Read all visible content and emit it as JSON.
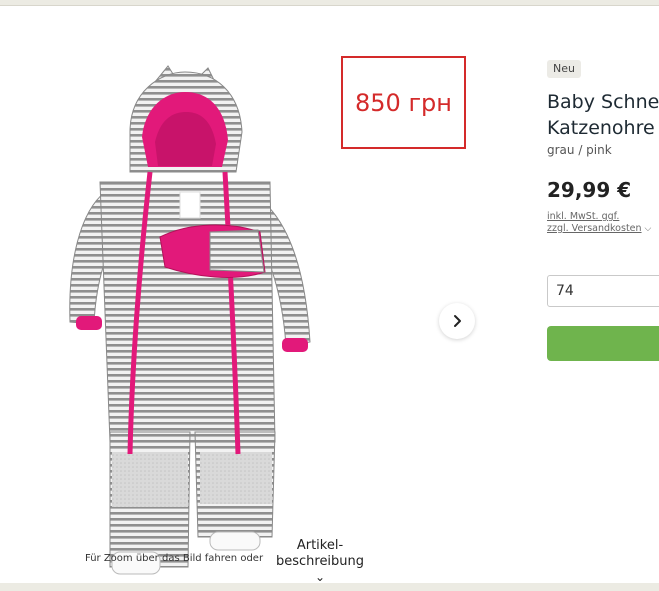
{
  "price_overlay": {
    "text": "850 грн"
  },
  "product": {
    "badge": "Neu",
    "title_line1": "Baby Schne",
    "title_line2": "Katzenohre",
    "color": "grau / pink",
    "price": "29,99 €",
    "tax_line1": "inkl. MwSt. ggf.",
    "tax_line2": "zzgl. Versandkosten",
    "size_value": "74"
  },
  "gallery": {
    "zoom_hint": "Für Zoom über das Bild fahren oder k",
    "next_icon": "chevron-right-icon"
  },
  "tabs": {
    "description_line1": "Artikel-",
    "description_line2": "beschreibung"
  },
  "colors": {
    "price_overlay": "#d42a2a",
    "cart_button": "#6fb44d",
    "garment_pink": "#e2197a",
    "garment_grey": "#9a9a9a"
  }
}
